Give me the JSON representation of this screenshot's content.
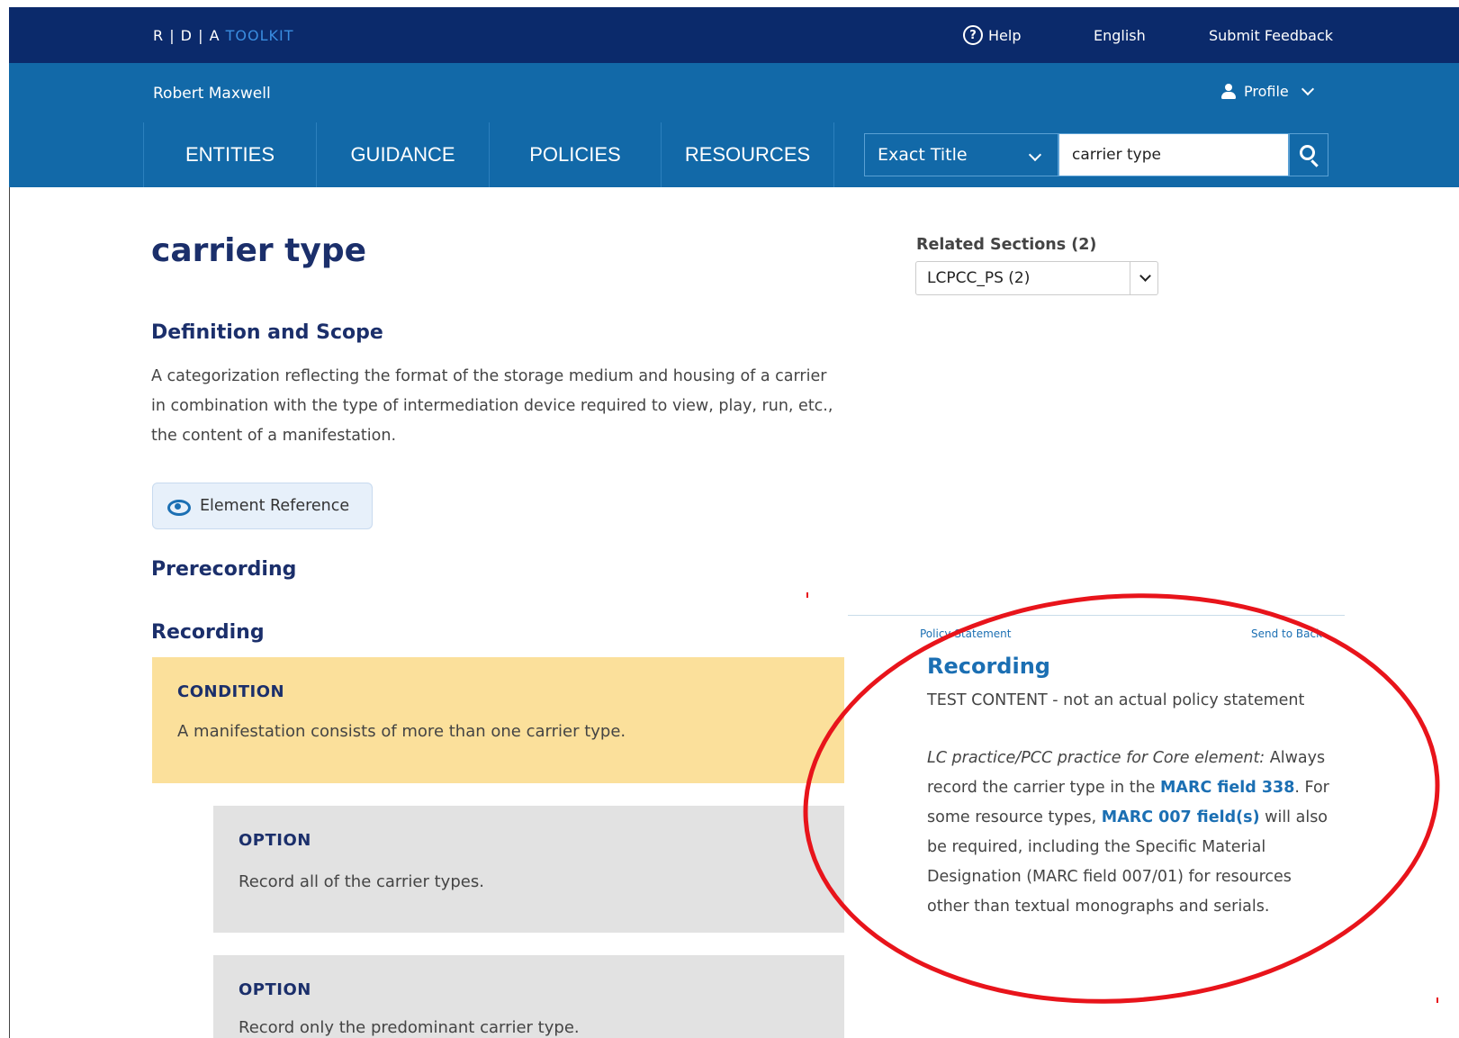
{
  "topbar": {
    "logo_main": "R | D | A",
    "logo_toolkit": " TOOLKIT",
    "help_icon_glyph": "?",
    "help": "Help",
    "language": "English",
    "feedback": "Submit Feedback"
  },
  "userbar": {
    "username": "Robert Maxwell",
    "profile": "Profile"
  },
  "nav": {
    "items": [
      "ENTITIES",
      "GUIDANCE",
      "POLICIES",
      "RESOURCES"
    ]
  },
  "search": {
    "mode": "Exact Title",
    "value": "carrier type"
  },
  "main": {
    "title": "carrier type",
    "definition_heading": "Definition and Scope",
    "definition_text": "A categorization reflecting the format of the storage medium and housing of a carrier in combination with the type of intermediation device required to view, play, run, etc., the content of a manifestation.",
    "element_reference": "Element Reference",
    "prerecording_heading": "Prerecording",
    "recording_heading": "Recording",
    "condition_label": "CONDITION",
    "condition_text": "A manifestation consists of more than one carrier type.",
    "options": [
      {
        "label": "OPTION",
        "text": "Record all of the carrier types."
      },
      {
        "label": "OPTION",
        "text": "Record only the predominant carrier type."
      }
    ]
  },
  "related": {
    "label": "Related Sections (2)",
    "selected": "LCPCC_PS (2)"
  },
  "policy": {
    "label": "Policy Statement",
    "send_to_back": "Send to Back",
    "title": "Recording",
    "test_content": "TEST CONTENT - not an actual policy statement",
    "italic_lead": "LC practice/PCC practice for Core element:",
    "text_1": " Always record the carrier type in the ",
    "link_1": "MARC field 338",
    "text_2": ". For some resource types, ",
    "link_2": "MARC 007 field(s)",
    "text_3": " will also be required, including the Specific Material Designation (MARC field 007/01) for resources other than textual monographs and serials."
  },
  "colors": {
    "topbar": "#0b2a6b",
    "userbar": "#1269a8",
    "heading": "#1b2f6b",
    "link": "#1b6fb3",
    "condition_bg": "#fbe09b",
    "option_bg": "#e2e2e2",
    "annotation": "#e8141b"
  },
  "icons": [
    "help-icon",
    "user-icon",
    "chevron-down-icon",
    "search-icon",
    "eye-icon"
  ]
}
